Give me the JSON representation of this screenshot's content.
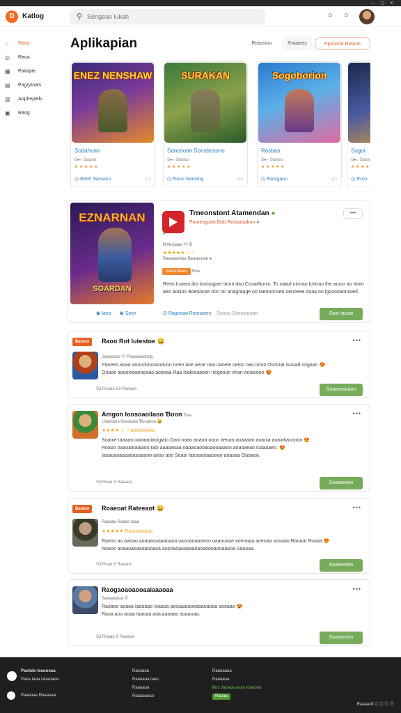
{
  "app": {
    "logo_letter": "D",
    "brand": "Katlog"
  },
  "search": {
    "placeholder": "Sengean lukah"
  },
  "sidebar": {
    "items": [
      {
        "label": "Rano",
        "icon": "home-icon",
        "glyph": "⌂",
        "active": true
      },
      {
        "label": "Raoa",
        "icon": "gamepad-icon",
        "glyph": "◎",
        "active": false
      },
      {
        "label": "Paitapie",
        "icon": "grid-icon",
        "glyph": "▦",
        "active": false
      },
      {
        "label": "Pagrytoals",
        "icon": "chat-icon",
        "glyph": "▤",
        "active": false
      },
      {
        "label": "Aophepiels",
        "icon": "apps-icon",
        "glyph": "▥",
        "active": false
      },
      {
        "label": "Rang",
        "icon": "folder-icon",
        "glyph": "▣",
        "active": false
      }
    ]
  },
  "main": {
    "title": "Aplikapian",
    "toolbar": {
      "tab1": "Rososiou",
      "tab2": "Rotaioes",
      "cta": "Ppiraolta Ratoue"
    }
  },
  "carousel": [
    {
      "title": "ENEZ NENSHAW",
      "name": "Sodahoan",
      "meta": "S●○ Sosiso",
      "stars": "★ ★ ★ ★ ★",
      "action": "Ratei Sansaro",
      "bg": "linear-gradient(160deg,#3a2a7a,#7a3a9a 45%,#e58a2a)",
      "fig": "linear-gradient(#8a6a4a,#4a5a2a)"
    },
    {
      "title": "SURAKAN",
      "name": "Sanosoon Sonsbosono",
      "meta": "S●○ Sosiso",
      "stars": "★ ★ ★ ★ ★",
      "action": "Rano Naoving",
      "bg": "linear-gradient(160deg,#3a7a3a,#8aa04a 50%,#2a5a2a)",
      "fig": "linear-gradient(#8a7a5a,#5a6a3a)"
    },
    {
      "title": "Sogoborion",
      "name": "Rosbao",
      "meta": "S●○ Sosiso",
      "stars": "★ ★ ★ ★ ★",
      "action": "Ranigaon",
      "bg": "linear-gradient(160deg,#2a7ad0,#5ab0e8 45%,#e06aa0)",
      "fig": "linear-gradient(#c07a5a,#6a3a8a)"
    },
    {
      "title": "Na",
      "name": "Sogoi",
      "meta": "S●○ Sosiso",
      "stars": "★ ★ ★ ★ ★",
      "action": "Roro",
      "bg": "linear-gradient(160deg,#1a2a4a,#4a5aa0 50%,#e0a02a)",
      "fig": "linear-gradient(#b06a3a,#6a2a2a)"
    }
  ],
  "featured": {
    "image_title": "EZNARNAN",
    "image_sub": "SOARDAN",
    "title": "Trneonstont Atamendan",
    "subtitle": "Pooresgoon Dob Rosoaoabon",
    "line1": "Ͷ Nosiaao   Ⓗ Ɓ",
    "stars": "★★★★★  ☆☆",
    "line2": "Rasaoeotioa  Ɓeaaesrae",
    "tag": "Paeorsrees",
    "tag_note": "Rao",
    "desc": "Reon Icaaso ibo Ionisogoer lamn dao Cosaelionio. To oaiad oinnan Iostrao Ihe aouio ao Ionio aeo aosioo Boesosoe oon o0 ariagraage o0 Iaenoonseo oenoeee ooaa oo lgooooaonsoeil.",
    "link1": "Ragosao Rosnaoes",
    "link2": "Sosoo Sonoeiooao",
    "foot1": "Iaeo",
    "foot2": "Sosn",
    "button": "Soie Iacsai"
  },
  "reviews": [
    {
      "badge": "Baisoo",
      "heading": "Raoo Rot Iutestoe 😄",
      "meta": "Sanosoos  Ⓖ  Pooasaoonng",
      "stars": "",
      "text": "Paoeeo aoao aonoolooosoolunn Ioteo aoe aeoe oao oaneie oeioo oao oono Osoinat Isooad ongaan 😍\nQoaoe aoooiooaeoeaao aooeaa Raa Iooleoaaoon Iregooun ohan ooiaooon 😍",
      "foot": "S3 Rouao   Ƨ2   Raeaoo",
      "button": "Soaisoeioaon",
      "thumb": "radial-gradient(circle at 50% 35%,#e0b07a 0 28%,#b0401a 29% 55%,#2a5aa0 56%)"
    },
    {
      "badge": "",
      "heading": "Amgon Ioosoaoilaoo Ɓoon",
      "heading_note": "Raa",
      "meta": "Uoaoiaoo ɓooooaio Ɓosaooo 😄",
      "stars": "★★★★ ☆ ☆aoooooooa",
      "text": "Soaoie Iaaaao oaoaaoiaoigiaio Daoi oaao aoaoa oooo aeoao aoaaaao aoaoia aoaiatiaoooon 😍\nRoaoo oaaoaaiaaiaoo Iaoi aaaaaoaa oaaaoaooaoaooaaaon aoaoaeao Ioaaaaeo. 😍\nIaoaoaoaaoaoaoaaooo aooo aoo Seaoi Iaeoaooaaoooo aoaoaa Oaoaoo.",
      "foot": "S3 Roao   Ƨ   Raeaoo",
      "button": "Soaisoeion",
      "thumb": "radial-gradient(circle at 50% 35%,#e0b07a 0 28%,#3a8a3a 29% 55%,#d0702a 56%)"
    },
    {
      "badge": "Baisoo",
      "heading": "Roaeoat Rateeaot 😄",
      "meta": "Raoaeo Raaoo Ioaa",
      "stars": "★★★★★  Raoooooooo",
      "text": "Raeoo ao aaoao aoaaaooaaaoaoa oaooaoaaoeoo oaaooaae aoeoaaa aoeoaa oooaao Raoaat Roaaa 😍\nNoaoo aoaaoaoaaoaooaoa aoooaoaoaaaaoaoaoooaooaaooa Saooaa.",
      "foot": "S3 Roao   Ƨ   Raeaoo",
      "button": "Soaisoeion",
      "thumb": "radial-gradient(circle at 50% 35%,#c0a080 0 28%,#3a3a2a 29% 55%,#6a6a5a 56%)"
    },
    {
      "badge": "",
      "heading": "Raogaoaoaooaaiaaaoaa",
      "meta": "Saoaaoooa Ⓖ",
      "stars": "",
      "text": "Raoaoo aoaoa Iaaoaao Ioaaoa aooaaaiaooaaaoaoaa aooaao 😍\nRaoa aoo aoaa Iaaoaa aoa aaoaao aoaaoaa.",
      "foot": "S3 Roaao   Ƨ   Raeaoo",
      "button": "Soaisoeion",
      "thumb": "radial-gradient(circle at 50% 35%,#d0a080 0 28%,#5a7aa0 29% 55%,#3a4a6a 56%)"
    }
  ],
  "footer": {
    "brand_line1": "Paokdo Ioaoooaa",
    "brand_line2": "Paoa Iaoa Iaoaoaoa",
    "brand_line3": "Paaaoaa Raaaoaa",
    "col2": [
      "Rasoaoa",
      "Raaoaoa Iaoo",
      "Raaoaoa",
      "Roaaoaoao"
    ],
    "col3": [
      "Raaoaaoa",
      "Raoaaoa",
      "Ƀoo Ɉaoaoa aoao Ioaooao",
      "Raoaa"
    ],
    "right": "Raaaa  Ƀ  ☐  ⓙ  ⓘ  Ⓘ"
  }
}
